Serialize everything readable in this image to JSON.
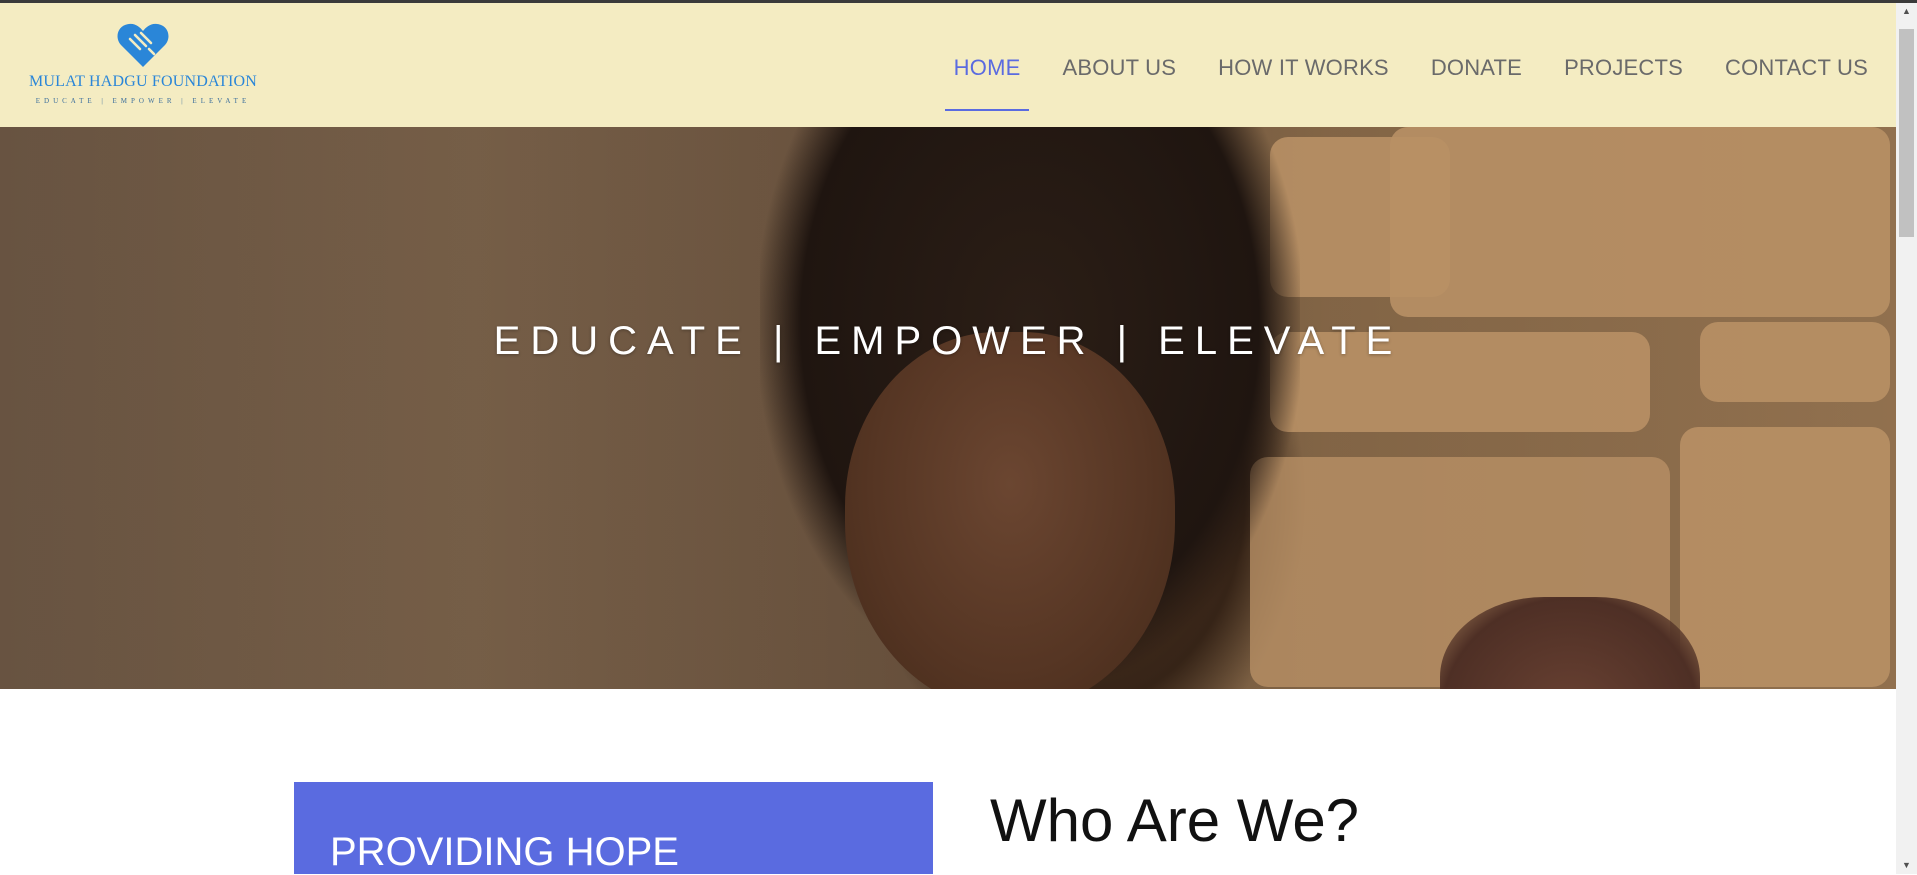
{
  "brand": {
    "name": "MULAT HADGU FOUNDATION",
    "tagline": "EDUCATE | EMPOWER | ELEVATE",
    "logo_icon": "heart-handshake-icon",
    "color": "#2a86d8"
  },
  "nav": {
    "items": [
      {
        "label": "HOME",
        "active": true
      },
      {
        "label": "ABOUT US",
        "active": false
      },
      {
        "label": "HOW IT WORKS",
        "active": false
      },
      {
        "label": "DONATE",
        "active": false
      },
      {
        "label": "PROJECTS",
        "active": false
      },
      {
        "label": "CONTACT US",
        "active": false
      }
    ],
    "active_color": "#5a6be0"
  },
  "hero": {
    "headline": "EDUCATE | EMPOWER | ELEVATE"
  },
  "card": {
    "title": "PROVIDING HOPE",
    "color": "#5a6be0"
  },
  "section": {
    "title": "Who Are We?"
  },
  "scrollbar": {
    "up_icon": "triangle-up-icon",
    "down_icon": "triangle-down-icon"
  }
}
